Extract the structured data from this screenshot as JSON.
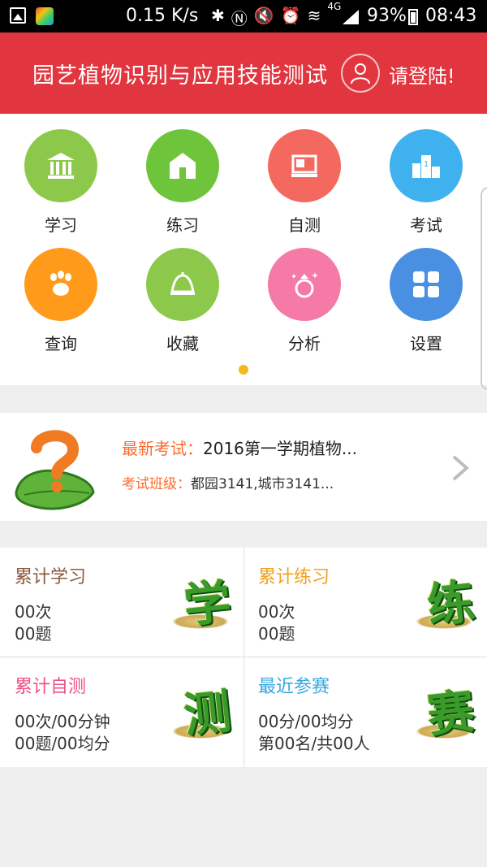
{
  "status_bar": {
    "speed": "0.15 K/s",
    "network": "4G",
    "battery": "93%",
    "time": "08:43"
  },
  "header": {
    "title": "园艺植物识别与应用技能测试",
    "login": "请登陆!"
  },
  "menu": [
    {
      "label": "学习",
      "color": "#8cc94a",
      "icon": "bank-icon"
    },
    {
      "label": "练习",
      "color": "#6ec43a",
      "icon": "house-icon"
    },
    {
      "label": "自测",
      "color": "#f4695f",
      "icon": "laptop-icon"
    },
    {
      "label": "考试",
      "color": "#3fb1ef",
      "icon": "podium-icon"
    },
    {
      "label": "查询",
      "color": "#ff9a1a",
      "icon": "paw-icon"
    },
    {
      "label": "收藏",
      "color": "#8cc94a",
      "icon": "bell-icon"
    },
    {
      "label": "分析",
      "color": "#f57aa6",
      "icon": "ring-icon"
    },
    {
      "label": "设置",
      "color": "#4a90e2",
      "icon": "grid-icon"
    }
  ],
  "exam": {
    "latest_key": "最新考试：",
    "latest_value": "2016第一学期植物...",
    "class_key": "考试班级：",
    "class_value": "都园3141,城市3141..."
  },
  "stats": [
    {
      "title": "累计学习",
      "title_color": "#8b5a3c",
      "line1": "00次",
      "line2": "00题",
      "big": "学"
    },
    {
      "title": "累计练习",
      "title_color": "#f0a020",
      "line1": "00次",
      "line2": "00题",
      "big": "练"
    },
    {
      "title": "累计自测",
      "title_color": "#f0508a",
      "line1": "00次/00分钟",
      "line2": "00题/00均分",
      "big": "测"
    },
    {
      "title": "最近参赛",
      "title_color": "#35a8e0",
      "line1": "00分/00均分",
      "line2": "第00名/共00人",
      "big": "赛"
    }
  ]
}
